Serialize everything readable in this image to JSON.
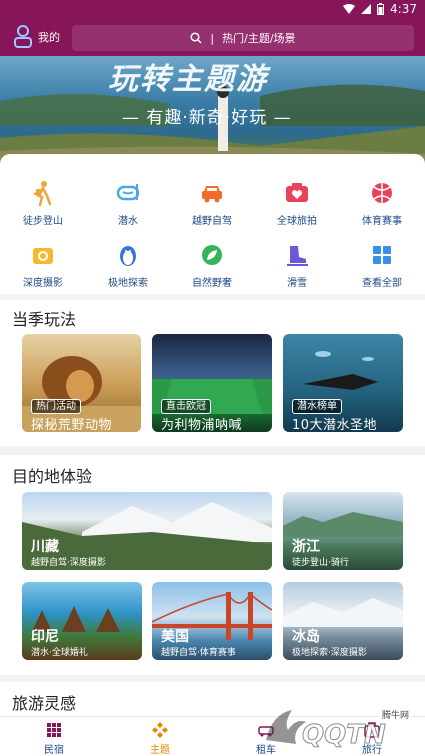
{
  "status_bar": {
    "time": "4:37"
  },
  "header": {
    "profile_label": "我的",
    "search_placeholder": "热门/主题/场景",
    "divider": "|"
  },
  "banner": {
    "title": "玩转主题游",
    "slogan": "— 有趣·新奇·好玩 —"
  },
  "categories": [
    {
      "label": "徒步登山",
      "icon": "hiking-icon"
    },
    {
      "label": "潜水",
      "icon": "diving-mask-icon"
    },
    {
      "label": "越野自驾",
      "icon": "car-icon"
    },
    {
      "label": "全球旅拍",
      "icon": "camera-heart-icon"
    },
    {
      "label": "体育赛事",
      "icon": "ball-icon"
    },
    {
      "label": "深度摄影",
      "icon": "camera-icon"
    },
    {
      "label": "极地探索",
      "icon": "penguin-icon"
    },
    {
      "label": "自然野奢",
      "icon": "leaf-icon"
    },
    {
      "label": "滑雪",
      "icon": "ski-boot-icon"
    },
    {
      "label": "查看全部",
      "icon": "grid-icon"
    }
  ],
  "seasonal": {
    "title": "当季玩法",
    "cards": [
      {
        "tag": "热门活动",
        "title": "探秘荒野动物"
      },
      {
        "tag": "直击欧冠",
        "title": "为利物浦呐喊"
      },
      {
        "tag": "潜水榜单",
        "title": "10大潜水圣地"
      }
    ]
  },
  "destinations": {
    "title": "目的地体验",
    "cards": [
      {
        "name": "川藏",
        "sub": "越野自驾·深度摄影"
      },
      {
        "name": "浙江",
        "sub": "徒步登山·骑行"
      },
      {
        "name": "印尼",
        "sub": "潜水·全球婚礼"
      },
      {
        "name": "美国",
        "sub": "越野自驾·体育赛事"
      },
      {
        "name": "冰岛",
        "sub": "极地探索·深度摄影"
      }
    ]
  },
  "inspiration": {
    "title": "旅游灵感"
  },
  "bottom_nav": [
    {
      "label": "民宿",
      "color": "#1e4a8a"
    },
    {
      "label": "主题",
      "color": "#e08a00"
    },
    {
      "label": "租车",
      "color": "#1e4a8a"
    },
    {
      "label": "旅行",
      "color": "#1e4a8a"
    }
  ],
  "watermark": {
    "text": "QQTN",
    "badge": "腾牛网"
  },
  "colors": {
    "brand": "#86155a",
    "accent": "#e08a00",
    "icon_orange": "#f2a33a"
  }
}
